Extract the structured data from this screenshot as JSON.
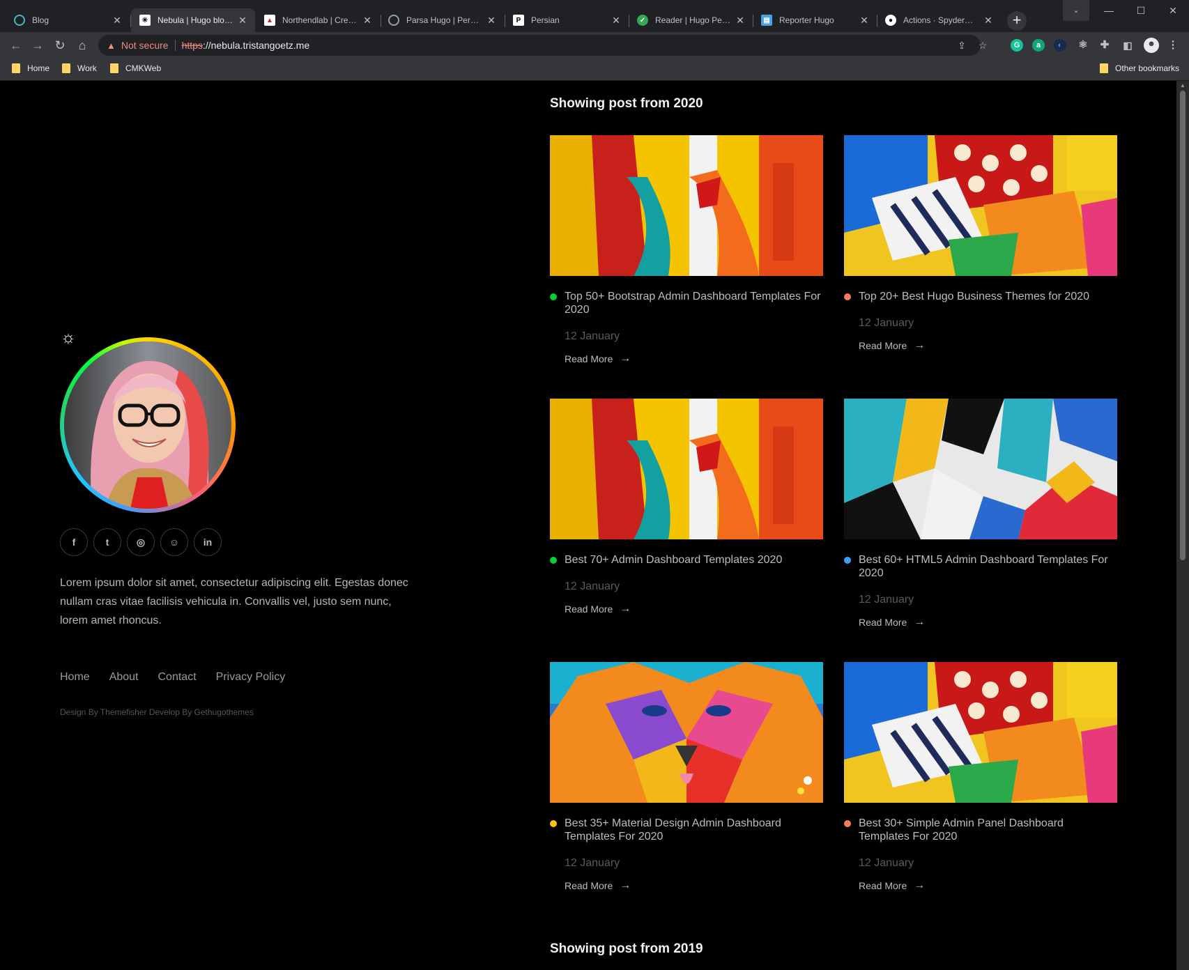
{
  "browser": {
    "tabs": [
      {
        "title": "Blog",
        "favicon": "globe-icon",
        "color": "#4ab7c6",
        "active": false
      },
      {
        "title": "Nebula | Hugo blog theme",
        "favicon": "nebula-icon",
        "color": "#ffffff",
        "active": true
      },
      {
        "title": "Northendlab | Creative",
        "favicon": "northendlab-icon",
        "color": "#c62828",
        "active": false
      },
      {
        "title": "Parsa Hugo | Personal",
        "favicon": "globe-icon",
        "color": "#9aa0a6",
        "active": false
      },
      {
        "title": "Persian",
        "favicon": "p-icon",
        "color": "#ffffff",
        "active": false
      },
      {
        "title": "Reader | Hugo Personal",
        "favicon": "reader-icon",
        "color": "#34a853",
        "active": false
      },
      {
        "title": "Reporter Hugo",
        "favicon": "reporter-icon",
        "color": "#4aa3df",
        "active": false
      },
      {
        "title": "Actions · SpyderHunter",
        "favicon": "github-icon",
        "color": "#ffffff",
        "active": false
      }
    ],
    "new_tab": "+",
    "address": {
      "warning": "Not secure",
      "scheme": "https",
      "rest": "://nebula.tristangoetz.me"
    },
    "bookmarks": [
      "Home",
      "Work",
      "CMKWeb"
    ],
    "other_bookmarks": "Other bookmarks"
  },
  "sidebar": {
    "bio": "Lorem ipsum dolor sit amet, consectetur adipiscing elit. Egestas donec nullam cras vitae facilisis vehicula in. Convallis vel, justo sem nunc, lorem amet rhoncus.",
    "socials": [
      {
        "name": "facebook-icon",
        "glyph": "f"
      },
      {
        "name": "twitter-icon",
        "glyph": "t"
      },
      {
        "name": "instagram-icon",
        "glyph": "◎"
      },
      {
        "name": "github-icon",
        "glyph": "☺"
      },
      {
        "name": "linkedin-icon",
        "glyph": "in"
      }
    ],
    "nav": [
      "Home",
      "About",
      "Contact",
      "Privacy Policy"
    ],
    "credit": "Design By Themefisher Develop By Gethugothemes"
  },
  "main": {
    "section_2020": "Showing post from 2020",
    "section_2019": "Showing post from 2019",
    "read_more": "Read More",
    "posts": [
      {
        "title": "Top 50+ Bootstrap Admin Dashboard Templates For 2020",
        "date": "12 January",
        "dot_color": "#00d13b",
        "image": "paint"
      },
      {
        "title": "Top 20+ Best Hugo Business Themes for 2020",
        "date": "12 January",
        "dot_color": "#ff7a59",
        "image": "pattern"
      },
      {
        "title": "Best 70+ Admin Dashboard Templates 2020",
        "date": "12 January",
        "dot_color": "#00d13b",
        "image": "paint"
      },
      {
        "title": "Best 60+ HTML5 Admin Dashboard Templates For 2020",
        "date": "12 January",
        "dot_color": "#3aa0ff",
        "image": "geo"
      },
      {
        "title": "Best 35+ Material Design Admin Dashboard Templates For 2020",
        "date": "12 January",
        "dot_color": "#ffc107",
        "image": "lion"
      },
      {
        "title": "Best 30+ Simple Admin Panel Dashboard Templates For 2020",
        "date": "12 January",
        "dot_color": "#ff7a59",
        "image": "pattern"
      }
    ]
  }
}
